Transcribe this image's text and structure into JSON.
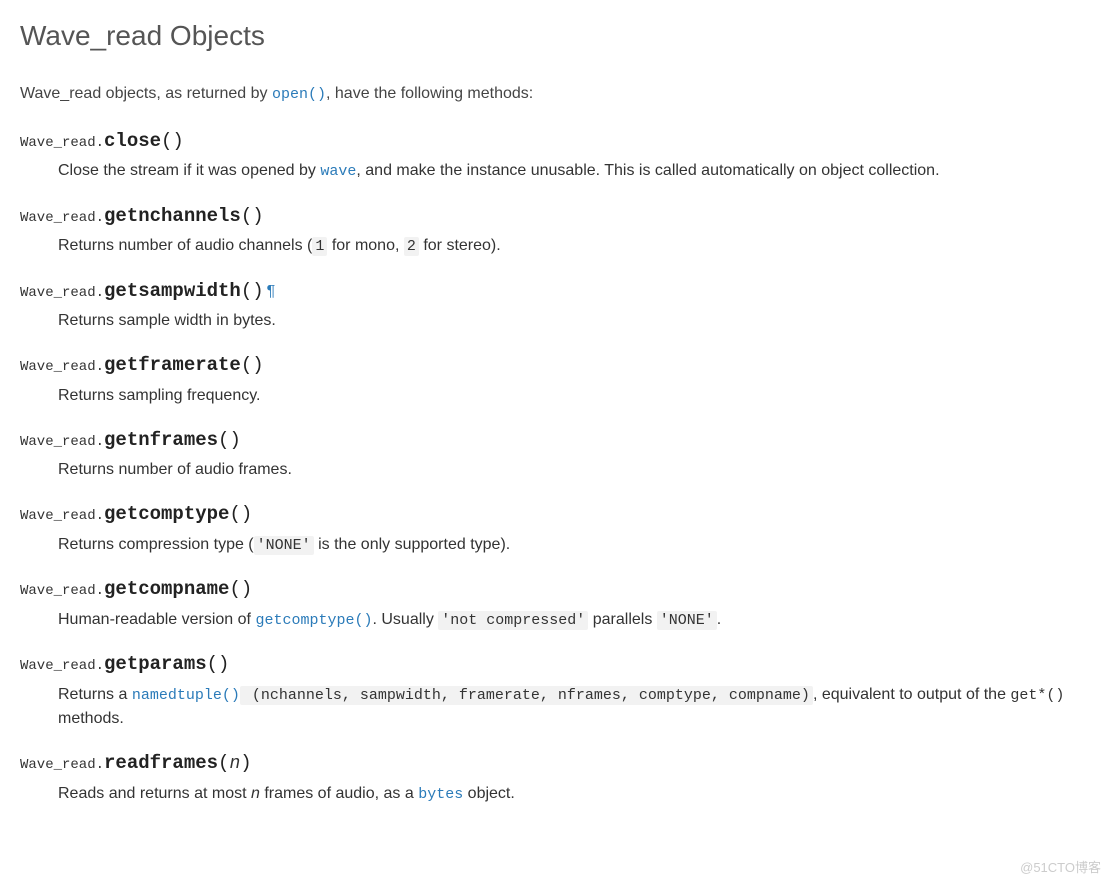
{
  "heading": "Wave_read Objects",
  "intro_pre": "Wave_read objects, as returned by ",
  "intro_link": "open()",
  "intro_post": ", have the following methods:",
  "class_prefix": "Wave_read.",
  "methods": {
    "close": {
      "name": "close",
      "parens": "()",
      "desc_pre": "Close the stream if it was opened by ",
      "desc_link": "wave",
      "desc_post": ", and make the instance unusable. This is called automatically on object collection."
    },
    "getnchannels": {
      "name": "getnchannels",
      "parens": "()",
      "desc_pre": "Returns number of audio channels (",
      "code1": "1",
      "mid": " for mono, ",
      "code2": "2",
      "desc_post": " for stereo)."
    },
    "getsampwidth": {
      "name": "getsampwidth",
      "parens": "()",
      "pilcrow": "¶",
      "desc": "Returns sample width in bytes."
    },
    "getframerate": {
      "name": "getframerate",
      "parens": "()",
      "desc": "Returns sampling frequency."
    },
    "getnframes": {
      "name": "getnframes",
      "parens": "()",
      "desc": "Returns number of audio frames."
    },
    "getcomptype": {
      "name": "getcomptype",
      "parens": "()",
      "desc_pre": "Returns compression type (",
      "code": "'NONE'",
      "desc_post": " is the only supported type)."
    },
    "getcompname": {
      "name": "getcompname",
      "parens": "()",
      "desc_pre": "Human-readable version of ",
      "link": "getcomptype()",
      "mid1": ". Usually ",
      "code1": "'not compressed'",
      "mid2": " parallels ",
      "code2": "'NONE'",
      "desc_post": "."
    },
    "getparams": {
      "name": "getparams",
      "parens": "()",
      "desc_pre": "Returns a ",
      "link": "namedtuple()",
      "code": " (nchannels, sampwidth, framerate, nframes, comptype, compname)",
      "mid": ", equivalent to output of the ",
      "code2": "get*()",
      "desc_post": " methods."
    },
    "readframes": {
      "name": "readframes",
      "paren_open": "(",
      "param": "n",
      "paren_close": ")",
      "desc_pre": "Reads and returns at most ",
      "em": "n",
      "mid": " frames of audio, as a ",
      "link": "bytes",
      "desc_post": " object."
    }
  },
  "watermark": "@51CTO博客"
}
